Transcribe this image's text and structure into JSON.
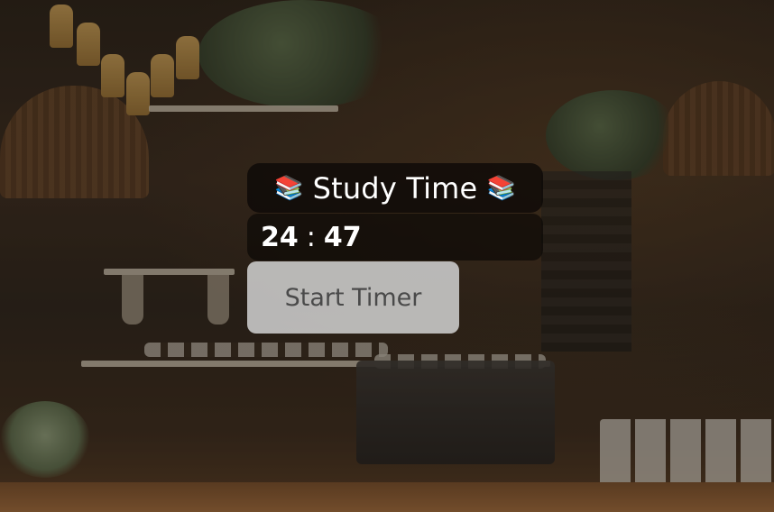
{
  "widget": {
    "title_emoji_left": "📚",
    "title": "Study Time",
    "title_emoji_right": "📚",
    "timer": {
      "minutes": "24",
      "separator": ":",
      "seconds": "47"
    },
    "start_button_label": "Start Timer"
  },
  "colors": {
    "panel_background": "#0c0806",
    "text_primary": "#ffffff",
    "button_background": "#cdcdcd",
    "button_text": "#4a4a4a"
  },
  "background": {
    "scene": "cafe interior with hanging plants, wicker lamps, shelves, espresso machine and jars"
  }
}
